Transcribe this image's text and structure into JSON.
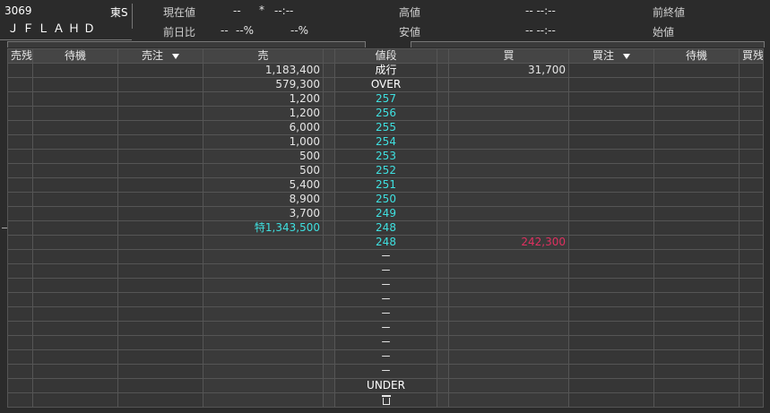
{
  "header": {
    "code": "3069",
    "market": "東S",
    "name": "ＪＦＬＡＨＤ",
    "current_label": "現在値",
    "current_value": "--",
    "current_flag": "*",
    "current_time": "--:--",
    "change_label": "前日比",
    "change_value": "--",
    "change_pct1": "--%",
    "change_pct2": "--%",
    "high_label": "高値",
    "high_value": "-- --:--",
    "low_label": "安値",
    "low_value": "-- --:--",
    "prev_close_label": "前終値",
    "open_label": "始値"
  },
  "columns": {
    "sell_remain": "売残",
    "sell_wait": "待機",
    "sell_order": "売注",
    "sell": "売",
    "price": "値段",
    "buy": "買",
    "buy_order": "買注",
    "buy_wait": "待機",
    "buy_remain": "買残"
  },
  "rows": [
    {
      "sell": "1,183,400",
      "price": "成行",
      "buy": "31,700",
      "pc": "w"
    },
    {
      "sell": "579,300",
      "price": "OVER",
      "buy": "",
      "pc": "w"
    },
    {
      "sell": "1,200",
      "price": "257",
      "buy": "",
      "pc": "c"
    },
    {
      "sell": "1,200",
      "price": "256",
      "buy": "",
      "pc": "c"
    },
    {
      "sell": "6,000",
      "price": "255",
      "buy": "",
      "pc": "c"
    },
    {
      "sell": "1,000",
      "price": "254",
      "buy": "",
      "pc": "c"
    },
    {
      "sell": "500",
      "price": "253",
      "buy": "",
      "pc": "c"
    },
    {
      "sell": "500",
      "price": "252",
      "buy": "",
      "pc": "c"
    },
    {
      "sell": "5,400",
      "price": "251",
      "buy": "",
      "pc": "c"
    },
    {
      "sell": "8,900",
      "price": "250",
      "buy": "",
      "pc": "c"
    },
    {
      "sell": "3,700",
      "price": "249",
      "buy": "",
      "pc": "c"
    },
    {
      "sell": "特1,343,500",
      "price": "248",
      "buy": "",
      "pc": "c",
      "sc": "c"
    },
    {
      "sell": "",
      "price": "248",
      "buy": "242,300",
      "pc": "c",
      "bc": "r"
    },
    {
      "sell": "",
      "price": "－",
      "buy": "",
      "pc": "w"
    },
    {
      "sell": "",
      "price": "－",
      "buy": "",
      "pc": "w"
    },
    {
      "sell": "",
      "price": "－",
      "buy": "",
      "pc": "w"
    },
    {
      "sell": "",
      "price": "－",
      "buy": "",
      "pc": "w"
    },
    {
      "sell": "",
      "price": "－",
      "buy": "",
      "pc": "w"
    },
    {
      "sell": "",
      "price": "－",
      "buy": "",
      "pc": "w"
    },
    {
      "sell": "",
      "price": "－",
      "buy": "",
      "pc": "w"
    },
    {
      "sell": "",
      "price": "－",
      "buy": "",
      "pc": "w"
    },
    {
      "sell": "",
      "price": "－",
      "buy": "",
      "pc": "w"
    },
    {
      "sell": "",
      "price": "UNDER",
      "buy": "",
      "pc": "w"
    }
  ],
  "footer": {
    "trash_icon": "trash-icon"
  },
  "colors": {
    "cyan": "#3fe0e0",
    "red": "#e03060",
    "bg": "#2b2b2b"
  }
}
